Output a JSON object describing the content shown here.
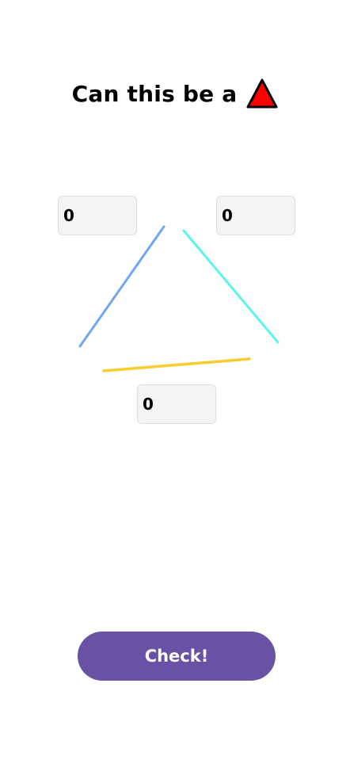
{
  "title": {
    "text": "Can this be a",
    "icon": "red-triangle-icon",
    "icon_fill": "#ff0000",
    "icon_stroke": "#000000"
  },
  "inputs": {
    "left_value": "0",
    "right_value": "0",
    "bottom_value": "0"
  },
  "lines": {
    "left_color": "#6ea8f5",
    "right_color": "#5ff3f0",
    "bottom_color": "#f7cd2e"
  },
  "check_button": {
    "label": "Check!",
    "color": "#6952a5"
  }
}
